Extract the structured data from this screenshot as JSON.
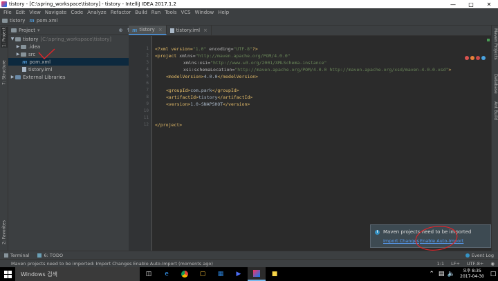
{
  "window": {
    "title": "tistory - [C:\\spring_workspace\\tistory] - tistory - IntelliJ IDEA 2017.1.2",
    "minimize_icon": "minimize-icon",
    "maximize_icon": "maximize-icon",
    "close_icon": "close-icon"
  },
  "menu": [
    "File",
    "Edit",
    "View",
    "Navigate",
    "Code",
    "Analyze",
    "Refactor",
    "Build",
    "Run",
    "Tools",
    "VCS",
    "Window",
    "Help"
  ],
  "navbar": {
    "project": "tistory",
    "file": "pom.xml"
  },
  "left_strip": {
    "project_tab": "1: Project",
    "structure_tab": "7: Structure",
    "favorites_tab": "2: Favorites"
  },
  "right_strip": {
    "maven_tab": "Maven Projects",
    "database_tab": "Database",
    "ant_tab": "Ant Build"
  },
  "project_panel": {
    "header": "Project",
    "tree": {
      "root_name": "tistory",
      "root_path": "C:\\spring_workspace\\tistory",
      "idea": ".idea",
      "src": "src",
      "pom": "pom.xml",
      "iml": "tistory.iml",
      "external": "External Libraries"
    }
  },
  "editor": {
    "tabs": [
      "tistory",
      "tistory.iml"
    ],
    "line_numbers": [
      "1",
      "2",
      "3",
      "4",
      "5",
      "6",
      "7",
      "8",
      "9",
      "10",
      "11",
      "12"
    ],
    "code": {
      "l1_a": "<?xml version=",
      "l1_b": "\"1.0\"",
      "l1_c": " encoding=",
      "l1_d": "\"UTF-8\"",
      "l1_e": "?>",
      "l2_a": "<project ",
      "l2_b": "xmlns=",
      "l2_c": "\"http://maven.apache.org/POM/4.0.0\"",
      "l3_a": "xmlns:xsi=",
      "l3_b": "\"http://www.w3.org/2001/XMLSchema-instance\"",
      "l4_a": "xsi:schemaLocation=",
      "l4_b": "\"http://maven.apache.org/POM/4.0.0 http://maven.apache.org/xsd/maven-4.0.0.xsd\"",
      "l4_c": ">",
      "l5_a": "<modelVersion>",
      "l5_b": "4.0.0",
      "l5_c": "</modelVersion>",
      "l7_a": "<groupId>",
      "l7_b": "com.park",
      "l7_c": "</groupId>",
      "l8_a": "<artifactId>",
      "l8_b": "tistory",
      "l8_c": "</artifactId>",
      "l9_a": "<version>",
      "l9_b": "1.0-SNAPSHOT",
      "l9_c": "</version>",
      "l12": "</project>"
    }
  },
  "notification": {
    "message": "Maven projects need to be imported",
    "import_changes": "Import Changes",
    "enable_auto_import": "Enable Auto-Import"
  },
  "bottom_tools": {
    "terminal": "Terminal",
    "todo": "6: TODO",
    "event_log": "Event Log"
  },
  "status": {
    "message": "Maven projects need to be imported: Import Changes    Enable Auto-Import (moments ago)",
    "position": "1:1",
    "line_sep": "LF÷",
    "encoding": "UTF-8÷"
  },
  "taskbar": {
    "search_placeholder": "Windows 검색",
    "time": "오후 8:35",
    "date": "2017-04-30"
  },
  "colors": {
    "annotation": "#e0252a",
    "accent": "#4a88c7",
    "link": "#589df6"
  }
}
